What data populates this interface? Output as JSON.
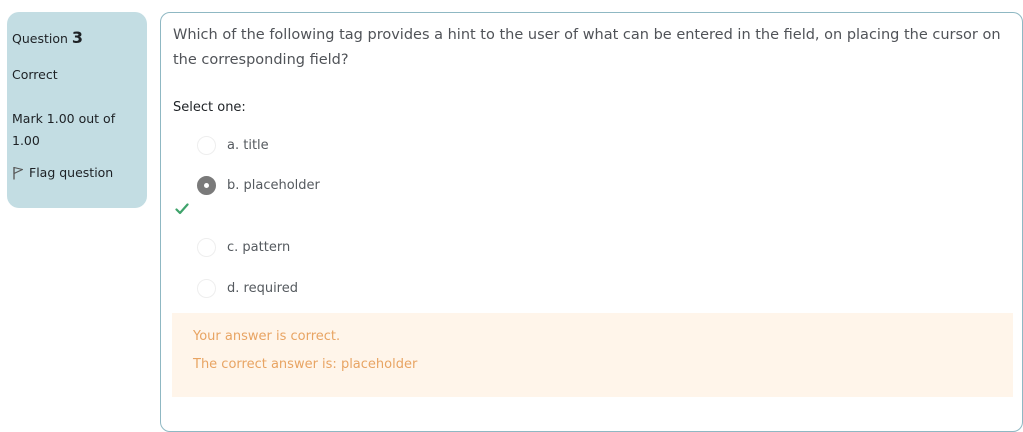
{
  "info": {
    "question_prefix": "Question",
    "question_number": "3",
    "state": "Correct",
    "grade": "Mark 1.00 out of 1.00",
    "flag_label": "Flag question",
    "flag_icon": "flag-icon"
  },
  "question": {
    "text": "Which of the following tag provides a hint to the user of what can be entered in the field, on placing the cursor on the corresponding field?",
    "prompt": "Select one:",
    "answers": [
      {
        "label": "a. title",
        "selected": false
      },
      {
        "label": "b. placeholder",
        "selected": true
      },
      {
        "label": "c. pattern",
        "selected": false
      },
      {
        "label": "d. required",
        "selected": false
      }
    ],
    "correct_icon": "check-icon"
  },
  "feedback": {
    "result": "Your answer is correct.",
    "right_answer": "The correct answer is: placeholder"
  },
  "colors": {
    "info_bg": "#c3dde3",
    "feedback_bg": "#fff5ea",
    "feedback_text": "#e8a463",
    "check": "#3fa36b"
  }
}
